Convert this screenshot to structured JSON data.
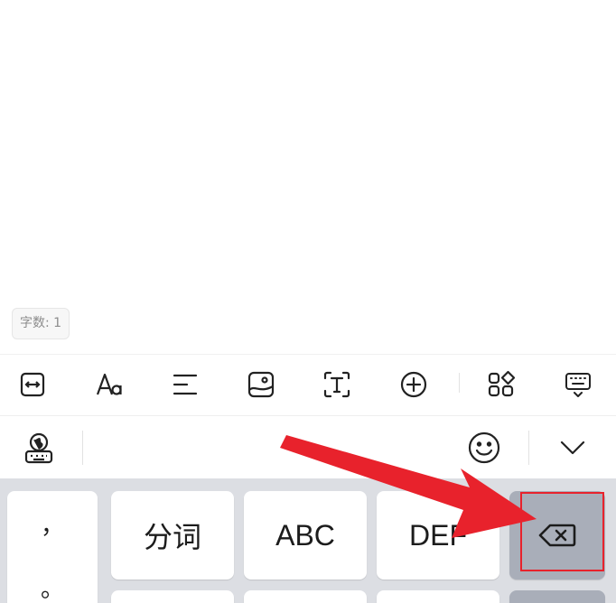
{
  "document": {
    "word_count": "字数: 1"
  },
  "format_toolbar": {
    "tools": [
      {
        "name": "text-width-icon"
      },
      {
        "name": "font-style-icon"
      },
      {
        "name": "align-icon"
      },
      {
        "name": "insert-image-icon"
      },
      {
        "name": "text-box-icon"
      },
      {
        "name": "insert-plus-icon"
      },
      {
        "name": "apps-grid-icon"
      },
      {
        "name": "hide-keyboard-icon"
      }
    ]
  },
  "ime_toolbar": {
    "left_icon": "keyboard-globe-icon",
    "emoji_icon": "emoji-icon",
    "collapse_icon": "chevron-down-icon"
  },
  "keyboard": {
    "punctuation": [
      "，",
      "。"
    ],
    "keys": [
      "分词",
      "ABC",
      "DEF"
    ],
    "backspace_icon": "backspace-icon"
  },
  "annotation": {
    "color": "#e8222c"
  }
}
